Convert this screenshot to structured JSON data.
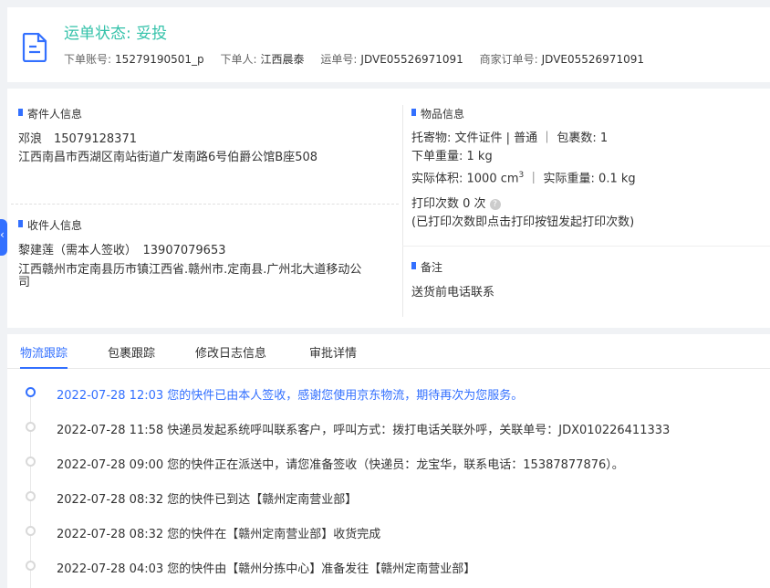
{
  "header": {
    "status_label": "运单状态: 妥投",
    "account_label": "下单账号:",
    "account_value": "15279190501_p",
    "orderer_label": "下单人:",
    "orderer_value": "江西晨泰",
    "waybill_label": "运单号:",
    "waybill_value": "JDVE05526971091",
    "merchant_label": "商家订单号:",
    "merchant_value": "JDVE05526971091"
  },
  "sender": {
    "title": "寄件人信息",
    "name_phone": "邓浪　15079128371",
    "address": "江西南昌市西湖区南站街道广发南路6号伯爵公馆B座508"
  },
  "receiver": {
    "title": "收件人信息",
    "name_phone": "黎建莲（需本人签收）　13907079653",
    "address_line1": "江西赣州市定南县历市镇江西省.赣州市.定南县.广州北大道移动公",
    "address_line2": "司"
  },
  "goods": {
    "title": "物品信息",
    "line1": "托寄物:  文件证件 | 普通 ｜ 包裹数:  1",
    "line2": "下单重量:   1 kg",
    "line3_prefix": "实际体积:    1000 cm",
    "line3_sup": "3",
    "line3_suffix": " ｜ 实际重量:    0.1 kg",
    "print_count": "打印次数    0 次",
    "help_glyph": "?",
    "print_note": "(已打印次数即点击打印按钮发起打印次数)"
  },
  "remark": {
    "title": "备注",
    "text": "送货前电话联系"
  },
  "tabs": [
    {
      "label": "物流跟踪"
    },
    {
      "label": "包裹跟踪"
    },
    {
      "label": "修改日志信息"
    },
    {
      "label": "审批详情"
    }
  ],
  "timeline": [
    {
      "text": "2022-07-28 12:03  您的快件已由本人签收，感谢您使用京东物流，期待再次为您服务。"
    },
    {
      "text": "2022-07-28 11:58  快递员发起系统呼叫联系客户，呼叫方式：拨打电话关联外呼，关联单号：JDX010226411333"
    },
    {
      "text": "2022-07-28 09:00  您的快件正在派送中，请您准备签收（快递员：龙宝华，联系电话：15387877876）。"
    },
    {
      "text": "2022-07-28 08:32  您的快件已到达【赣州定南营业部】"
    },
    {
      "text": "2022-07-28 08:32  您的快件在【赣州定南营业部】收货完成"
    },
    {
      "text": "2022-07-28 04:03  您的快件由【赣州分拣中心】准备发往【赣州定南营业部】"
    }
  ],
  "colors": {
    "accent": "#3370ff",
    "status": "#34c2aa"
  },
  "icons": {
    "header": "document-icon",
    "side": "collapse-arrow-icon",
    "help": "help-icon"
  }
}
